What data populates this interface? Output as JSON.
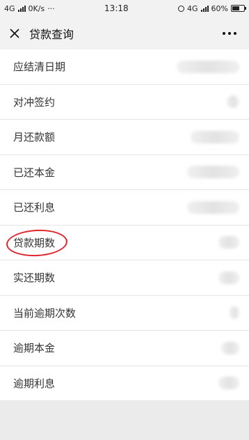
{
  "status_bar": {
    "network_left": "4G",
    "speed": "0K/s",
    "dots": "···",
    "time": "13:18",
    "network_right": "4G",
    "battery_percent": "60%",
    "battery_level": 0.6
  },
  "nav": {
    "title": "贷款查询",
    "close_icon": "close-icon",
    "more_icon": "more-icon"
  },
  "rows": [
    {
      "label": "应结清日期",
      "value": ""
    },
    {
      "label": "对冲签约",
      "value": ""
    },
    {
      "label": "月还款额",
      "value": ""
    },
    {
      "label": "已还本金",
      "value": ""
    },
    {
      "label": "已还利息",
      "value": ""
    },
    {
      "label": "贷款期数",
      "value": ""
    },
    {
      "label": "实还期数",
      "value": ""
    },
    {
      "label": "当前逾期次数",
      "value": ""
    },
    {
      "label": "逾期本金",
      "value": ""
    },
    {
      "label": "逾期利息",
      "value": ""
    }
  ],
  "annotation": {
    "color": "#e0242c",
    "target": "贷款期数"
  }
}
